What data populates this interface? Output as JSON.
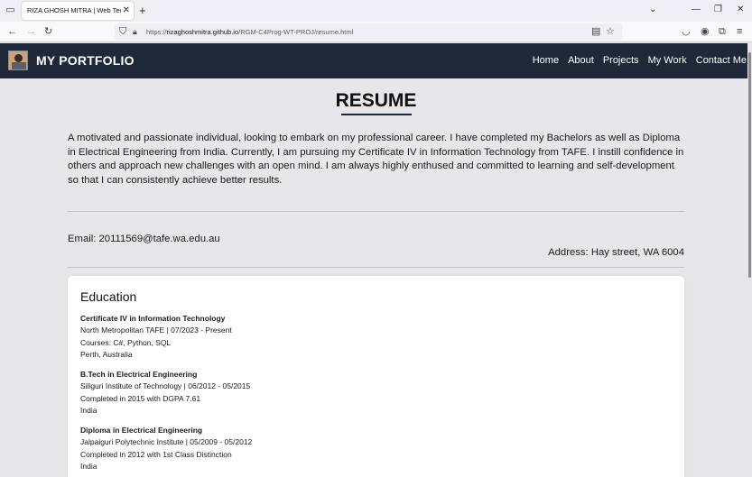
{
  "browser": {
    "tab_title": "RIZA GHOSH MITRA | Web Tech | C",
    "url_prefix": "https://",
    "url_host": "rizaghoshmitra.github.io",
    "url_path": "/RGM-C4Prog-WT-PROJ/resume.html"
  },
  "site": {
    "brand": "MY PORTFOLIO",
    "nav": [
      "Home",
      "About",
      "Projects",
      "My Work",
      "Contact Me"
    ]
  },
  "resume": {
    "title": "RESUME",
    "summary": "A motivated and passionate individual, looking to embark on my professional career. I have completed my Bachelors as well as Diploma in Electrical Engineering from India. Currently, I am pursuing my Certificate IV in Information Technology from TAFE. I instill confidence in others and approach new challenges with an open mind. I am always highly enthused and committed to learning and self-development so that I can consistently achieve better results.",
    "email": "Email: 20111569@tafe.wa.edu.au",
    "address": "Address: Hay street, WA 6004"
  },
  "education": {
    "heading": "Education",
    "items": [
      {
        "degree": "Certificate IV in Information Technology",
        "institution": "North Metropolitan TAFE | 07/2023 - Present",
        "detail": "Courses: C#, Python, SQL",
        "location": "Perth, Australia"
      },
      {
        "degree": "B.Tech in Electrical Engineering",
        "institution": "Siliguri Institute of Technology | 06/2012 - 05/2015",
        "detail": "Completed in 2015 with DGPA 7.61",
        "location": "India"
      },
      {
        "degree": "Diploma in Electrical Engineering",
        "institution": "Jalpaiguri Polytechnic Institute | 05/2009 - 05/2012",
        "detail": "Completed in 2012 with 1st Class Distinction",
        "location": "India"
      }
    ]
  }
}
